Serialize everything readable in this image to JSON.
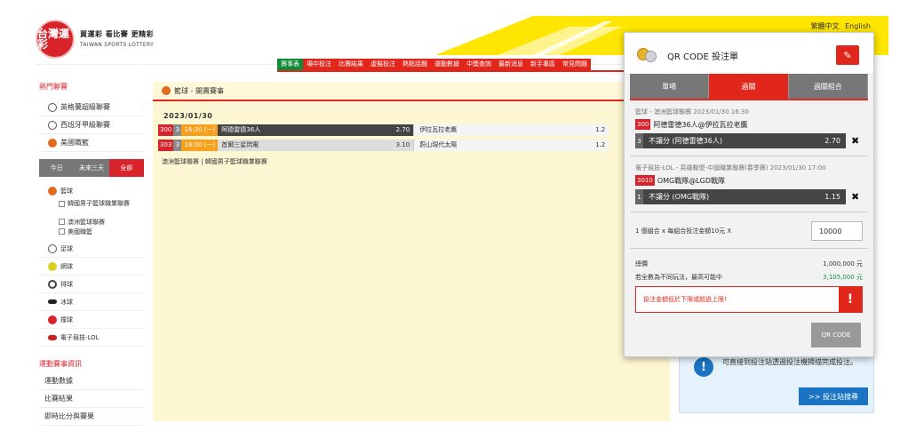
{
  "brand": {
    "logo_cn": "台灣運彩",
    "tagline_cn": "買運彩 看比賽 更精彩",
    "tagline_en": "TAIWAN SPORTS LOTTERY"
  },
  "lang": {
    "zh": "繁體中文",
    "en": "English"
  },
  "topnav": [
    "賽事表",
    "場中投注",
    "比賽結果",
    "虛擬投注",
    "熱點話題",
    "運動數據",
    "中獎查詢",
    "最新消息",
    "新手專區",
    "常見問題"
  ],
  "sidebar": {
    "hot_title": "熱門聯賽",
    "hot_items": [
      "英格蘭超級聯賽",
      "西班牙甲級聯賽",
      "美國職籃"
    ],
    "tabs": [
      "今日",
      "未來三天",
      "全部"
    ],
    "sports": [
      {
        "label": "籃球",
        "color": "#e16a1c"
      },
      {
        "label": "足球",
        "color": "#666666"
      },
      {
        "label": "網球",
        "color": "#d9d11f"
      },
      {
        "label": "排球",
        "color": "#444444"
      },
      {
        "label": "冰球",
        "color": "#222222"
      },
      {
        "label": "撞球",
        "color": "#d8232a"
      },
      {
        "label": "電子競技-LOL",
        "color": "#c22"
      }
    ],
    "basketball_subs": [
      "韓國男子籃球職業聯賽",
      "澳洲籃球聯賽",
      "美國職籃"
    ],
    "info_title": "運動賽事資訊",
    "info_items": [
      "運動數據",
      "比賽結果",
      "即時比分與賽果"
    ]
  },
  "main": {
    "header": "籃球 - 開賣賽事",
    "date": "2023/01/30",
    "rows": [
      {
        "num": "300",
        "n": "3",
        "time": "16:30 (一)",
        "home": "阿德雷德36人",
        "home_odds": "2.70",
        "away": "伊拉瓦拉老鷹",
        "away_odds": "1.2"
      },
      {
        "num": "303",
        "n": "3",
        "time": "18:00 (一)",
        "home": "首爾三星閃電",
        "home_odds": "3.10",
        "away": "蔚山現代太陽",
        "away_odds": "1.2"
      }
    ],
    "footnote": "澳洲籃球聯賽 | 韓國男子籃球職業聯賽"
  },
  "popup": {
    "title": "QR CODE 投注單",
    "tabs": [
      "單場",
      "過關",
      "過關組合"
    ],
    "bets": [
      {
        "league": "籃球 - 澳洲籃球聯賽 2023/01/30 16:30",
        "num": "300",
        "match": "阿德雷德36人@伊拉瓦拉老鷹",
        "pick_n": "3",
        "pick": "不讓分 (阿德雷德36人)",
        "odds": "2.70"
      },
      {
        "league": "電子競技-LOL - 英雄聯盟-中國職業聯賽(春季賽) 2023/01/30 17:00",
        "num": "3010",
        "match": "OMG戰隊@LGD戰隊",
        "pick_n": "1",
        "pick": "不讓分 (OMG戰隊)",
        "odds": "1.15"
      }
    ],
    "combo_text": "1 個組合 x 每組合投注金額10元 X",
    "amount": "10000",
    "total_label": "總價",
    "total_value": "1,000,000 元",
    "max_label": "若全數為不同玩法，最高可能中",
    "max_value": "3,105,000 元",
    "warning": "投注金額低於下限或超過上限!",
    "qr_button": "QR CODE"
  },
  "infobox": {
    "text": "前往投注賣事，依後再掃描生投注 QR-Code，可直接到投注站透過投注機掃描完成投注。",
    "button": ">> 投注站搜尋"
  }
}
